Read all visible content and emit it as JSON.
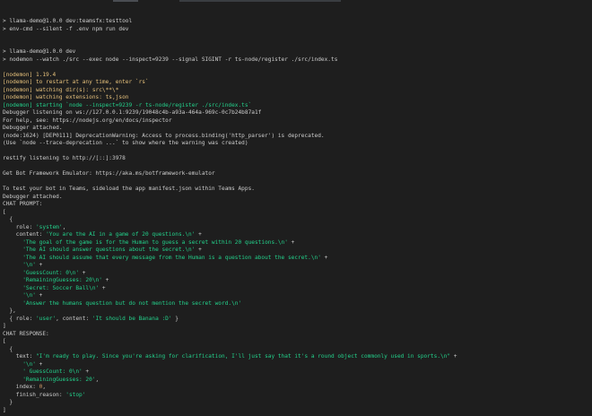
{
  "window": {
    "accent": "#23d18b",
    "background": "#1e1e1e",
    "foreground": "#cccccc"
  },
  "terminal": {
    "lines": [
      [
        {
          "t": "> llama-demo@1.0.0 dev:teamsfx:testtool",
          "c": "d"
        }
      ],
      [
        {
          "t": "> env-cmd --silent -f .env npm run dev",
          "c": "d"
        }
      ],
      [
        {
          "t": "",
          "c": "d"
        }
      ],
      [
        {
          "t": "",
          "c": "d"
        }
      ],
      [
        {
          "t": "> llama-demo@1.0.0 dev",
          "c": "d"
        }
      ],
      [
        {
          "t": "> nodemon --watch ./src --exec node --inspect=9239 --signal SIGINT -r ts-node/register ./src/index.ts",
          "c": "d"
        }
      ],
      [
        {
          "t": "",
          "c": "d"
        }
      ],
      [
        {
          "t": "[nodemon] 1.19.4",
          "c": "y"
        }
      ],
      [
        {
          "t": "[nodemon] to restart at any time, enter `rs`",
          "c": "y"
        }
      ],
      [
        {
          "t": "[nodemon] watching dir(s): src\\**\\*",
          "c": "y"
        }
      ],
      [
        {
          "t": "[nodemon] watching extensions: ts,json",
          "c": "y"
        }
      ],
      [
        {
          "t": "[nodemon] starting `node --inspect=9239 -r ts-node/register ./src/index.ts`",
          "c": "g"
        }
      ],
      [
        {
          "t": "Debugger listening on ws://127.0.0.1:9239/19048c4b-a93a-464a-969c-0c7b24b87a1f",
          "c": "d"
        }
      ],
      [
        {
          "t": "For help, see: https://nodejs.org/en/docs/inspector",
          "c": "d"
        }
      ],
      [
        {
          "t": "Debugger attached.",
          "c": "d"
        }
      ],
      [
        {
          "t": "(node:1624) [DEP0111] DeprecationWarning: Access to process.binding('http_parser') is deprecated.",
          "c": "d"
        }
      ],
      [
        {
          "t": "(Use `node --trace-deprecation ...` to show where the warning was created)",
          "c": "d"
        }
      ],
      [
        {
          "t": "",
          "c": "d"
        }
      ],
      [
        {
          "t": "restify listening to http://[::]:3978",
          "c": "d"
        }
      ],
      [
        {
          "t": "",
          "c": "d"
        }
      ],
      [
        {
          "t": "Get Bot Framework Emulator: https://aka.ms/botframework-emulator",
          "c": "d"
        }
      ],
      [
        {
          "t": "",
          "c": "d"
        }
      ],
      [
        {
          "t": "To test your bot in Teams, sideload the app manifest.json within Teams Apps.",
          "c": "d"
        }
      ],
      [
        {
          "t": "Debugger attached.",
          "c": "d"
        }
      ],
      [
        {
          "t": "CHAT PROMPT:",
          "c": "d"
        }
      ],
      [
        {
          "t": "[",
          "c": "d"
        }
      ],
      [
        {
          "t": "  {",
          "c": "d"
        }
      ],
      [
        {
          "t": "    role: ",
          "c": "d"
        },
        {
          "t": "'system'",
          "c": "g"
        },
        {
          "t": ",",
          "c": "d"
        }
      ],
      [
        {
          "t": "    content: ",
          "c": "d"
        },
        {
          "t": "'You are the AI in a game of 20 questions.\\n'",
          "c": "g"
        },
        {
          "t": " +",
          "c": "d"
        }
      ],
      [
        {
          "t": "      ",
          "c": "d"
        },
        {
          "t": "'The goal of the game is for the Human to guess a secret within 20 questions.\\n'",
          "c": "g"
        },
        {
          "t": " +",
          "c": "d"
        }
      ],
      [
        {
          "t": "      ",
          "c": "d"
        },
        {
          "t": "'The AI should answer questions about the secret.\\n'",
          "c": "g"
        },
        {
          "t": " +",
          "c": "d"
        }
      ],
      [
        {
          "t": "      ",
          "c": "d"
        },
        {
          "t": "'The AI should assume that every message from the Human is a question about the secret.\\n'",
          "c": "g"
        },
        {
          "t": " +",
          "c": "d"
        }
      ],
      [
        {
          "t": "      ",
          "c": "d"
        },
        {
          "t": "'\\n'",
          "c": "g"
        },
        {
          "t": " +",
          "c": "d"
        }
      ],
      [
        {
          "t": "      ",
          "c": "d"
        },
        {
          "t": "'GuessCount: 0\\n'",
          "c": "g"
        },
        {
          "t": " +",
          "c": "d"
        }
      ],
      [
        {
          "t": "      ",
          "c": "d"
        },
        {
          "t": "'RemainingGuesses: 20\\n'",
          "c": "g"
        },
        {
          "t": " +",
          "c": "d"
        }
      ],
      [
        {
          "t": "      ",
          "c": "d"
        },
        {
          "t": "'Secret: Soccer Ball\\n'",
          "c": "g"
        },
        {
          "t": " +",
          "c": "d"
        }
      ],
      [
        {
          "t": "      ",
          "c": "d"
        },
        {
          "t": "'\\n'",
          "c": "g"
        },
        {
          "t": " +",
          "c": "d"
        }
      ],
      [
        {
          "t": "      ",
          "c": "d"
        },
        {
          "t": "'Answer the humans question but do not mention the secret word.\\n'",
          "c": "g"
        }
      ],
      [
        {
          "t": "  },",
          "c": "d"
        }
      ],
      [
        {
          "t": "  { role: ",
          "c": "d"
        },
        {
          "t": "'user'",
          "c": "g"
        },
        {
          "t": ", content: ",
          "c": "d"
        },
        {
          "t": "'It should be Banana :D'",
          "c": "g"
        },
        {
          "t": " }",
          "c": "d"
        }
      ],
      [
        {
          "t": "]",
          "c": "d"
        }
      ],
      [
        {
          "t": "CHAT RESPONSE:",
          "c": "d"
        }
      ],
      [
        {
          "t": "[",
          "c": "d"
        }
      ],
      [
        {
          "t": "  {",
          "c": "d"
        }
      ],
      [
        {
          "t": "    text: ",
          "c": "d"
        },
        {
          "t": "\"I'm ready to play. Since you're asking for clarification, I'll just say that it's a round object commonly used in sports.\\n\"",
          "c": "g"
        },
        {
          "t": " +",
          "c": "d"
        }
      ],
      [
        {
          "t": "      ",
          "c": "d"
        },
        {
          "t": "'\\n'",
          "c": "g"
        },
        {
          "t": " +",
          "c": "d"
        }
      ],
      [
        {
          "t": "      ",
          "c": "d"
        },
        {
          "t": "' GuessCount: 0\\n'",
          "c": "g"
        },
        {
          "t": " +",
          "c": "d"
        }
      ],
      [
        {
          "t": "      ",
          "c": "d"
        },
        {
          "t": "'RemainingGuesses: 20'",
          "c": "g"
        },
        {
          "t": ",",
          "c": "d"
        }
      ],
      [
        {
          "t": "    index: ",
          "c": "d"
        },
        {
          "t": "0",
          "c": "n"
        },
        {
          "t": ",",
          "c": "d"
        }
      ],
      [
        {
          "t": "    finish_reason: ",
          "c": "d"
        },
        {
          "t": "'stop'",
          "c": "g"
        }
      ],
      [
        {
          "t": "  }",
          "c": "d"
        }
      ],
      [
        {
          "t": "]",
          "c": "d"
        }
      ]
    ]
  }
}
